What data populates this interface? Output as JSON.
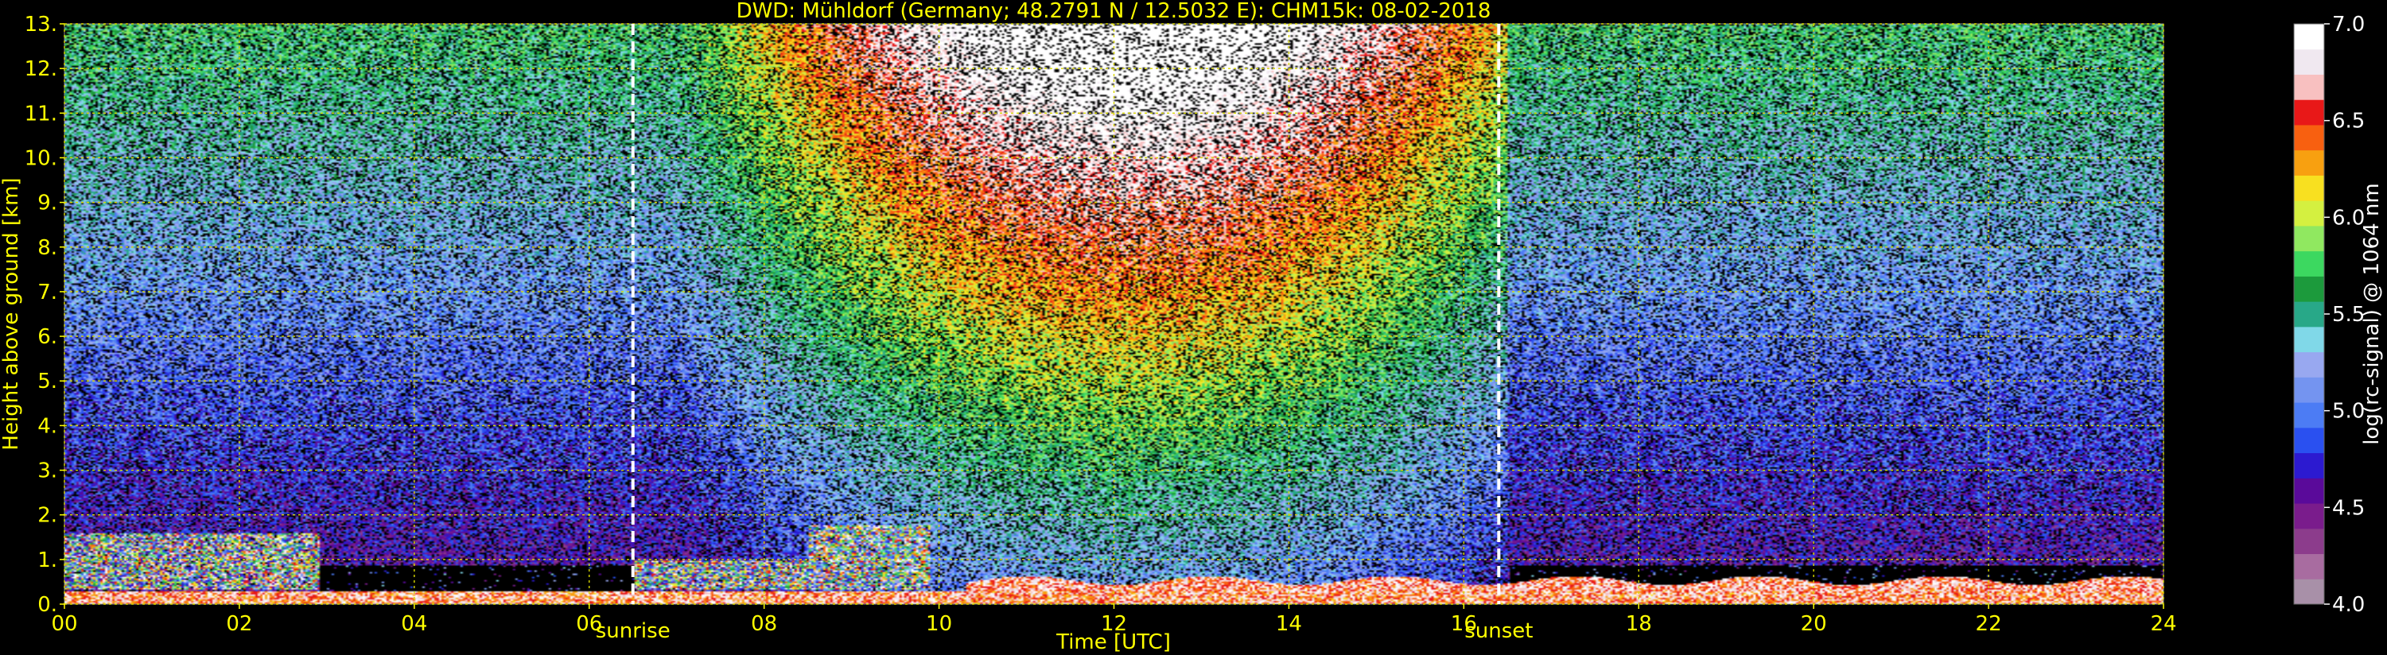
{
  "chart_data": {
    "type": "heatmap",
    "title": "DWD: Mühldorf (Germany; 48.2791 N / 12.5032 E):    CHM15k: 08-02-2018",
    "xlabel": "Time [UTC]",
    "ylabel": "Height above ground [km]",
    "colorbar_label": "log(rc-signal) @ 1064 nm",
    "xlim": [
      0,
      24
    ],
    "ylim": [
      0,
      13
    ],
    "x_ticks": [
      "00",
      "02",
      "04",
      "06",
      "08",
      "10",
      "12",
      "14",
      "16",
      "18",
      "20",
      "22",
      "24"
    ],
    "y_ticks": [
      "0.",
      "1.",
      "2.",
      "3.",
      "4.",
      "5.",
      "6.",
      "7.",
      "8.",
      "9.",
      "10.",
      "11.",
      "12.",
      "13."
    ],
    "colorbar_range": [
      4.0,
      7.0
    ],
    "colorbar_ticks": [
      "4.0",
      "4.5",
      "5.0",
      "5.5",
      "6.0",
      "6.5",
      "7.0"
    ],
    "grid": true,
    "markers": [
      {
        "label": "sunrise",
        "time": 6.5
      },
      {
        "label": "sunset",
        "time": 16.4
      }
    ],
    "colors": {
      "text": "#ffff00",
      "grid": "#d8d800",
      "background": "#000000",
      "marker": "#ffffff",
      "colorbar_label": "#ffffff"
    },
    "colormap": [
      "#a890a8",
      "#a86ca0",
      "#8c3c8c",
      "#7a1c8c",
      "#5a0a9a",
      "#2c1ad0",
      "#2a50f0",
      "#4c7cf4",
      "#7494f0",
      "#98a8f0",
      "#80d8e8",
      "#28a888",
      "#1c9a3c",
      "#3cd860",
      "#90e860",
      "#d4f040",
      "#f8e020",
      "#f8a010",
      "#f86010",
      "#e81818",
      "#f8c0c0",
      "#f0e8f0",
      "#ffffff"
    ]
  }
}
